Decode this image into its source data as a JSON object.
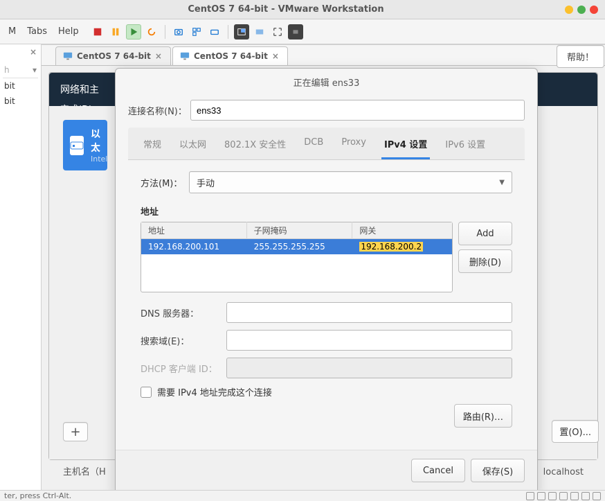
{
  "window": {
    "title": "CentOS 7 64-bit - VMware Workstation"
  },
  "menubar": {
    "items": [
      "M",
      "Tabs",
      "Help"
    ]
  },
  "left_panel": {
    "search_placeholder": "Search",
    "tree_items": [
      "bit",
      "bit"
    ]
  },
  "vm_tabs": [
    {
      "label": "CentOS 7 64-bit",
      "active": false
    },
    {
      "label": "CentOS 7 64-bit",
      "active": true
    }
  ],
  "net_window": {
    "title": "网络和主",
    "done": "完成(D)",
    "eth_card": {
      "title": "以太",
      "sub": "Intel"
    },
    "plus": "+",
    "hostname_label": "主机名（H",
    "hostname_value": "localhost",
    "help": "帮助！",
    "config": "置(O)..."
  },
  "dialog": {
    "title": "正在编辑 ens33",
    "conn_label": "连接名称(N)：",
    "conn_value": "ens33",
    "tabs": [
      "常规",
      "以太网",
      "802.1X 安全性",
      "DCB",
      "Proxy",
      "IPv4 设置",
      "IPv6 设置"
    ],
    "active_tab": "IPv4 设置",
    "method_label": "方法(M)：",
    "method_value": "手动",
    "addr_section": "地址",
    "addr_headers": {
      "addr": "地址",
      "mask": "子网掩码",
      "gw": "网关"
    },
    "addr_rows": [
      {
        "addr": "192.168.200.101",
        "mask": "255.255.255.255",
        "gw": "192.168.200.2"
      }
    ],
    "add_btn": "Add",
    "del_btn": "删除(D)",
    "dns_label": "DNS 服务器：",
    "search_label": "搜索域(E)：",
    "dhcp_label": "DHCP 客户端 ID：",
    "chk_label": "需要 IPv4 地址完成这个连接",
    "route_btn": "路由(R)…",
    "cancel_btn": "Cancel",
    "save_btn": "保存(S)"
  },
  "statusbar": {
    "left": "ter, press Ctrl-Alt."
  }
}
